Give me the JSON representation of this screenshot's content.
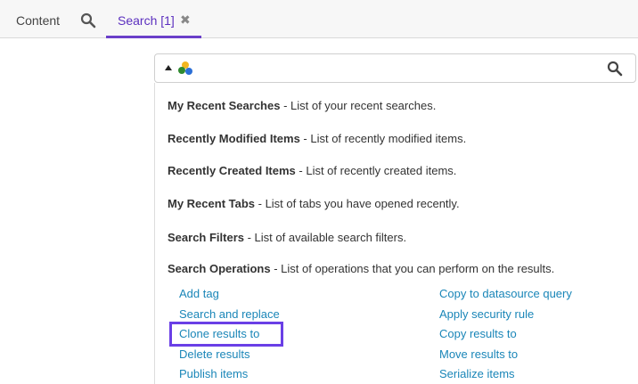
{
  "tabs": {
    "content_label": "Content",
    "search_tab_label": "Search [1]",
    "close_glyph": "✖",
    "search_icon": "search-icon"
  },
  "searchbox": {
    "value": "",
    "left_icons": [
      "caret-up-icon",
      "database-icon"
    ],
    "right_icon": "search-icon"
  },
  "sections": [
    {
      "title": "My Recent Searches",
      "desc": " - List of your recent searches."
    },
    {
      "title": "Recently Modified Items",
      "desc": " - List of recently modified items."
    },
    {
      "title": "Recently Created Items",
      "desc": " - List of recently created items."
    },
    {
      "title": "My Recent Tabs",
      "desc": " - List of tabs you have opened recently."
    },
    {
      "title": "Search Filters",
      "desc": " - List of available search filters."
    },
    {
      "title": "Search Operations",
      "desc": " - List of operations that you can perform on the results."
    }
  ],
  "operations": {
    "left": [
      "Add tag",
      "Search and replace",
      "Clone results to",
      "Delete results",
      "Publish items"
    ],
    "right": [
      "Copy to datasource query",
      "Apply security rule",
      "Copy results to",
      "Move results to",
      "Serialize items"
    ]
  },
  "colors": {
    "accent": "#6a3fc9",
    "link": "#1a86b8",
    "highlight_box": "#6a3fe6"
  }
}
